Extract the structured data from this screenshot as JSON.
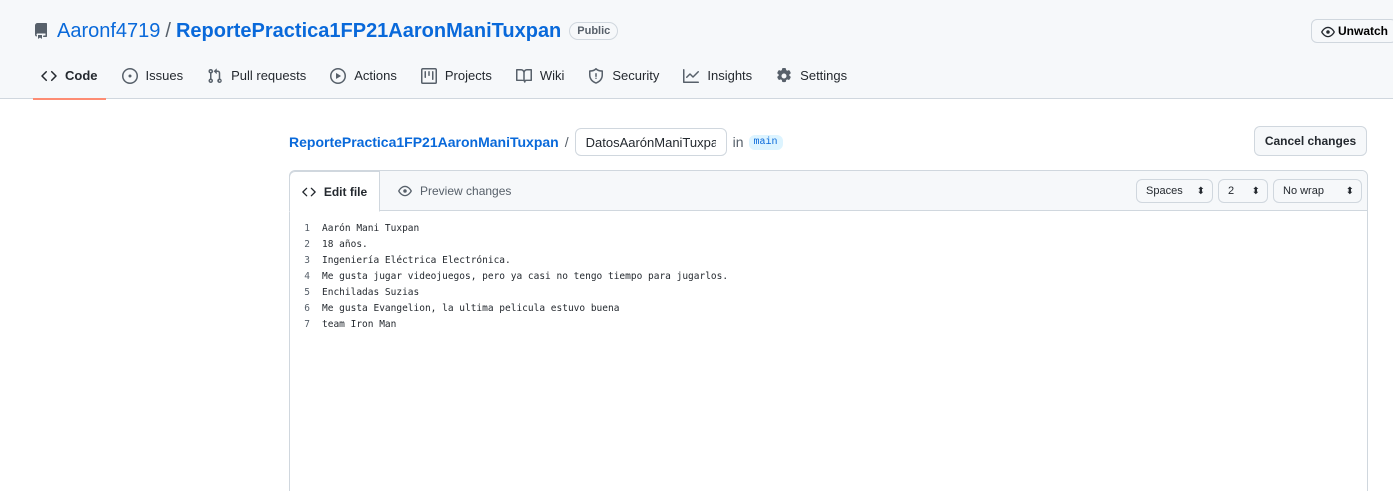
{
  "repo": {
    "owner": "Aaronf4719",
    "separator": "/",
    "name": "ReportePractica1FP21AaronManiTuxpan",
    "visibility": "Public",
    "watch_label": "Unwatch"
  },
  "nav_tabs": [
    {
      "label": "Code",
      "icon": "code-icon",
      "active": true
    },
    {
      "label": "Issues",
      "icon": "issue-opened-icon"
    },
    {
      "label": "Pull requests",
      "icon": "git-pull-request-icon"
    },
    {
      "label": "Actions",
      "icon": "play-icon"
    },
    {
      "label": "Projects",
      "icon": "table-icon"
    },
    {
      "label": "Wiki",
      "icon": "book-icon"
    },
    {
      "label": "Security",
      "icon": "shield-icon"
    },
    {
      "label": "Insights",
      "icon": "graph-icon"
    },
    {
      "label": "Settings",
      "icon": "gear-icon"
    }
  ],
  "edit_path": {
    "repo": "ReportePractica1FP21AaronManiTuxpan",
    "separator": "/",
    "filename": "DatosAarónManiTuxpan",
    "in_label": "in",
    "branch": "main"
  },
  "cancel_label": "Cancel changes",
  "editor": {
    "edit_tab": "Edit file",
    "preview_tab": "Preview changes",
    "indent_mode": "Spaces",
    "indent_size": "2",
    "wrap_mode": "No wrap",
    "lines": [
      {
        "n": "1",
        "text": "Aarón Mani Tuxpan"
      },
      {
        "n": "2",
        "text": "18 años."
      },
      {
        "n": "3",
        "text": "Ingeniería Eléctrica Electrónica."
      },
      {
        "n": "4",
        "text": "Me gusta jugar videojuegos, pero ya casi no tengo tiempo para jugarlos."
      },
      {
        "n": "5",
        "text": "Enchiladas Suzias"
      },
      {
        "n": "6",
        "text": "Me gusta Evangelion, la ultima pelicula estuvo buena"
      },
      {
        "n": "7",
        "text": "team Iron Man"
      }
    ]
  },
  "colors": {
    "link": "#0969da",
    "active_tab_underline": "#fd8c73",
    "header_bg": "#f6f8fa",
    "border": "#d0d7de"
  }
}
